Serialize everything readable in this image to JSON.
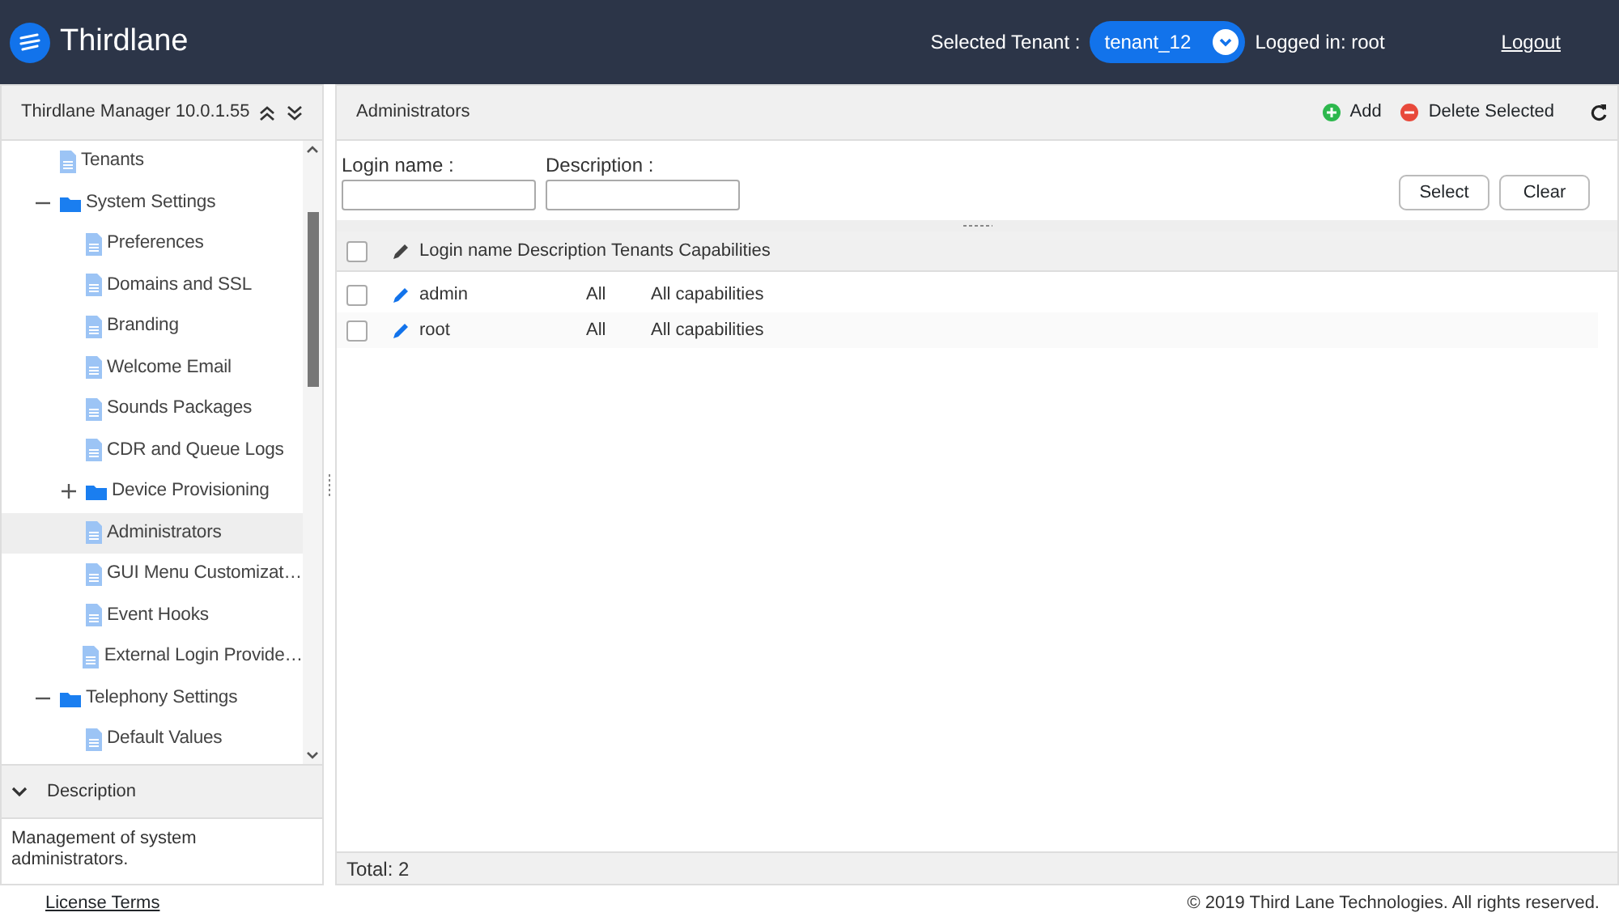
{
  "header": {
    "brand": "Thirdlane",
    "tenant_label": "Selected Tenant :",
    "tenant": "tenant_12",
    "logged_in": "Logged in: root",
    "logout": "Logout"
  },
  "sidebar": {
    "title": "Thirdlane Manager 10.0.1.55",
    "tree": [
      {
        "label": "Tenants",
        "kind": "page",
        "selected": false
      },
      {
        "label": "System Settings",
        "kind": "folder",
        "expanded": true,
        "selected": false,
        "children": [
          {
            "label": "Preferences",
            "kind": "page",
            "selected": false
          },
          {
            "label": "Domains and SSL",
            "kind": "page",
            "selected": false
          },
          {
            "label": "Branding",
            "kind": "page",
            "selected": false
          },
          {
            "label": "Welcome Email",
            "kind": "page",
            "selected": false
          },
          {
            "label": "Sounds Packages",
            "kind": "page",
            "selected": false
          },
          {
            "label": "CDR and Queue Logs",
            "kind": "page",
            "selected": false
          },
          {
            "label": "Device Provisioning",
            "kind": "folder",
            "expanded": false,
            "selected": false
          },
          {
            "label": "Administrators",
            "kind": "page",
            "selected": true
          },
          {
            "label": "GUI Menu Customizat…",
            "kind": "page",
            "selected": false
          },
          {
            "label": "Event Hooks",
            "kind": "page",
            "selected": false
          },
          {
            "label": "External Login Provide…",
            "kind": "page",
            "selected": false
          }
        ]
      },
      {
        "label": "Telephony Settings",
        "kind": "folder",
        "expanded": true,
        "selected": false,
        "children": [
          {
            "label": "Default Values",
            "kind": "page",
            "selected": false
          }
        ]
      }
    ],
    "description_title": "Description",
    "description": "Management of system administrators."
  },
  "main": {
    "title": "Administrators",
    "add": "Add",
    "delete": "Delete Selected",
    "filters": [
      {
        "label": "Login name :"
      },
      {
        "label": "Description :"
      }
    ],
    "buttons": [
      "Select",
      "Clear"
    ],
    "table": {
      "all_checked": false,
      "columns": [
        "Login name",
        "Description",
        "Tenants",
        "Capabilities"
      ],
      "rows": [
        {
          "cells": [
            "admin",
            "",
            "All",
            "All capabilities"
          ],
          "checked": false
        },
        {
          "cells": [
            "root",
            "",
            "All",
            "All capabilities"
          ],
          "checked": false
        }
      ]
    },
    "total": "Total: 2"
  },
  "footer": {
    "license": "License Terms",
    "copyright": "© 2019 Third Lane Technologies. All rights reserved."
  }
}
